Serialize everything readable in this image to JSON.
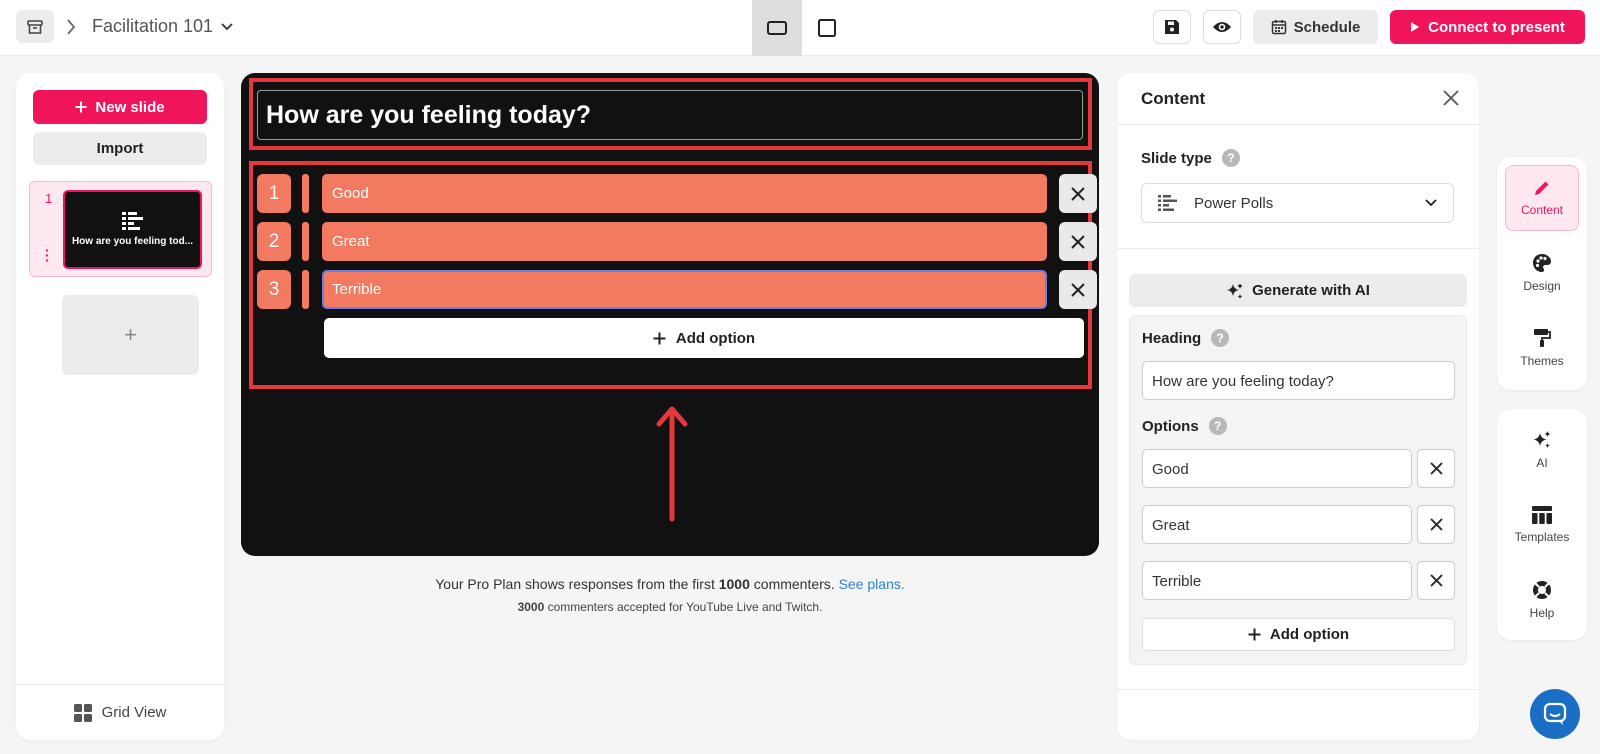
{
  "topbar": {
    "project_title": "Facilitation 101",
    "schedule_label": "Schedule",
    "present_label": "Connect to present"
  },
  "sidebar": {
    "new_slide_label": "New slide",
    "import_label": "Import",
    "slides": [
      {
        "number": "1",
        "title": "How are you feeling tod..."
      }
    ],
    "add_slide_symbol": "+",
    "grid_view_label": "Grid View"
  },
  "canvas": {
    "heading": "How are you feeling today?",
    "options": [
      {
        "number": "1",
        "label": "Good"
      },
      {
        "number": "2",
        "label": "Great"
      },
      {
        "number": "3",
        "label": "Terrible"
      }
    ],
    "add_option_label": "Add option"
  },
  "plan_note": {
    "prefix": "Your Pro Plan shows responses from the first ",
    "limit": "1000",
    "suffix": " commenters. ",
    "link": "See plans.",
    "accepted_count": "3000",
    "accepted_suffix": " commenters accepted for YouTube Live and Twitch."
  },
  "content_panel": {
    "title": "Content",
    "slide_type_label": "Slide type",
    "slide_type_value": "Power Polls",
    "generate_ai_label": "Generate with AI",
    "heading_label": "Heading",
    "heading_value": "How are you feeling today?",
    "options_label": "Options",
    "options": [
      "Good",
      "Great",
      "Terrible"
    ],
    "add_option_label": "Add option",
    "help_symbol": "?"
  },
  "rail": {
    "top": [
      {
        "label": "Content"
      },
      {
        "label": "Design"
      },
      {
        "label": "Themes"
      }
    ],
    "bottom": [
      {
        "label": "AI"
      },
      {
        "label": "Templates"
      },
      {
        "label": "Help"
      }
    ]
  },
  "colors": {
    "brand_pink": "#f0145a",
    "option_coral": "#f27a61",
    "annotation_red": "#e5383b",
    "canvas_bg": "#111111",
    "link_blue": "#2f7fd3",
    "chat_blue": "#1a6fc4"
  }
}
